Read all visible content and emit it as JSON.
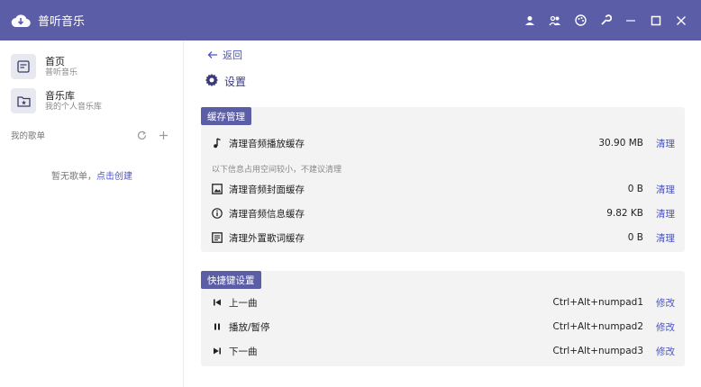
{
  "app": {
    "title": "普听音乐"
  },
  "titlebar": {
    "icons": [
      "user-icon",
      "people-icon",
      "palette-icon",
      "wrench-icon",
      "minimize-icon",
      "maximize-icon",
      "close-icon"
    ]
  },
  "sidebar": {
    "items": [
      {
        "title": "首页",
        "subtitle": "普听音乐",
        "icon": "home-list-icon"
      },
      {
        "title": "音乐库",
        "subtitle": "我的个人音乐库",
        "icon": "folder-star-icon"
      }
    ],
    "playlist_label": "我的歌单",
    "empty_text": "暂无歌单，",
    "empty_link": "点击创建"
  },
  "main": {
    "back_label": "返回",
    "page_title": "设置",
    "cache": {
      "title": "缓存管理",
      "hint": "以下信息占用空间较小，不建议清理",
      "rows": [
        {
          "label": "清理音频播放缓存",
          "value": "30.90 MB",
          "action": "清理",
          "icon": "music-note-icon"
        },
        {
          "label": "清理音频封面缓存",
          "value": "0 B",
          "action": "清理",
          "icon": "image-icon"
        },
        {
          "label": "清理音频信息缓存",
          "value": "9.82 KB",
          "action": "清理",
          "icon": "info-icon"
        },
        {
          "label": "清理外置歌词缓存",
          "value": "0 B",
          "action": "清理",
          "icon": "document-icon"
        }
      ]
    },
    "shortcuts": {
      "title": "快捷键设置",
      "rows": [
        {
          "label": "上一曲",
          "value": "Ctrl+Alt+numpad1",
          "action": "修改",
          "icon": "skip-previous-icon"
        },
        {
          "label": "播放/暂停",
          "value": "Ctrl+Alt+numpad2",
          "action": "修改",
          "icon": "pause-icon"
        },
        {
          "label": "下一曲",
          "value": "Ctrl+Alt+numpad3",
          "action": "修改",
          "icon": "skip-next-icon"
        }
      ]
    }
  },
  "colors": {
    "accent": "#5b5ea6",
    "link": "#4a54c2",
    "section_bg": "#f3f3f3"
  }
}
